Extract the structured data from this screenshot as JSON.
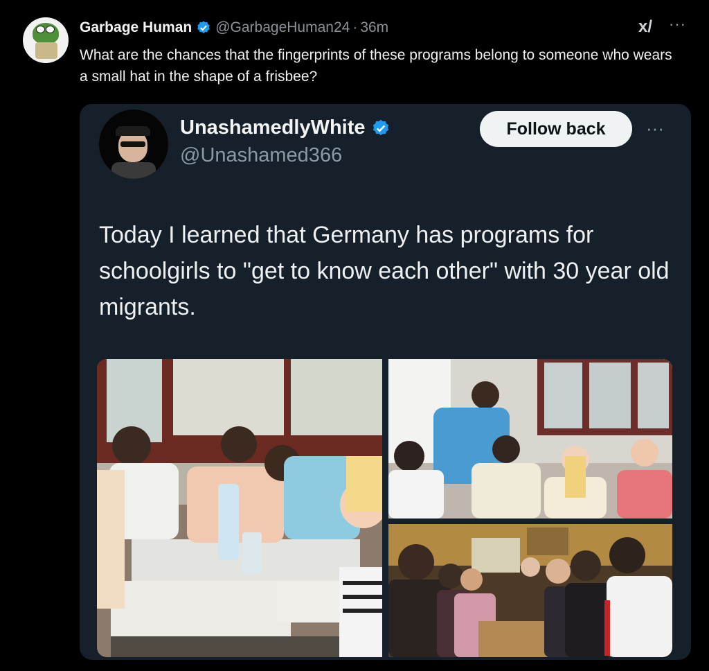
{
  "tweet": {
    "author_name": "Garbage Human",
    "handle": "@GarbageHuman24",
    "separator": "·",
    "time": "36m",
    "text": "What are the chances that the fingerprints of these programs belong to someone who wears a small hat in the shape of a frisbee?"
  },
  "quote": {
    "author_name": "UnashamedlyWhite",
    "handle": "@Unashamed366",
    "follow_label": "Follow back",
    "text": "Today I learned that Germany has programs for schoolgirls to \"get to know each other\" with 30 year old migrants."
  },
  "icons": {
    "verified": "verified-badge-icon",
    "grok": "grok-icon",
    "more": "more-icon"
  },
  "colors": {
    "background": "#000000",
    "card": "#15202b",
    "verified": "#1d9bf0",
    "follow_button": "#eff3f4"
  }
}
